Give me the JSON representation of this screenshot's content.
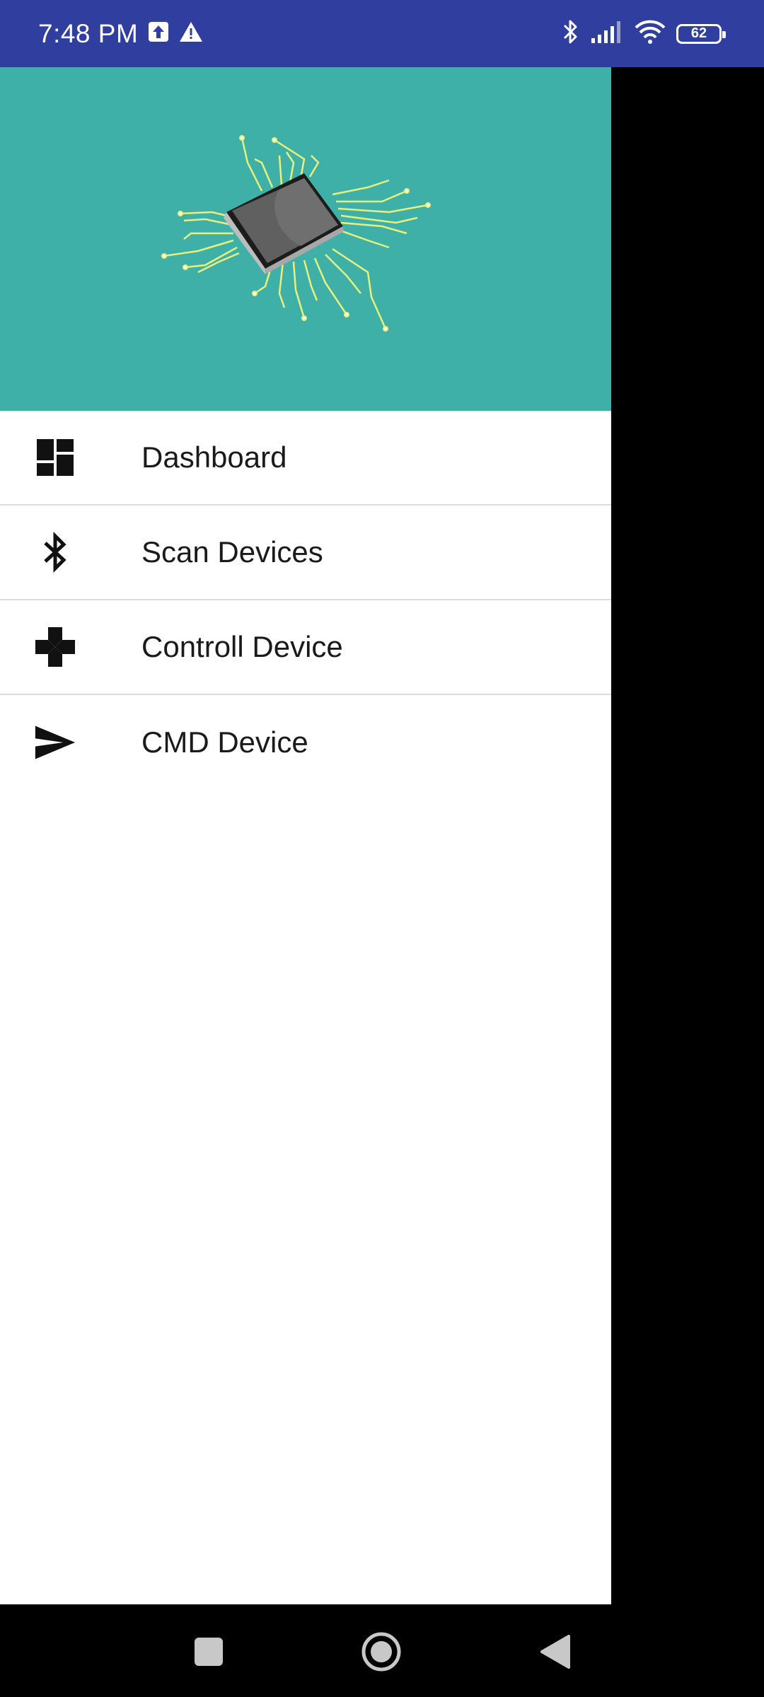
{
  "status_bar": {
    "time": "7:48 PM",
    "battery_level": "62",
    "icons": [
      "upload-icon",
      "warning-icon",
      "bluetooth-icon",
      "signal-icon",
      "wifi-icon",
      "battery-icon"
    ]
  },
  "drawer": {
    "header_image": "microchip-illustration",
    "header_color": "#3fb0a8",
    "items": [
      {
        "label": "Dashboard",
        "icon": "dashboard-icon"
      },
      {
        "label": "Scan Devices",
        "icon": "bluetooth-icon"
      },
      {
        "label": "Controll Device",
        "icon": "gamepad-icon"
      },
      {
        "label": "CMD Device",
        "icon": "send-icon"
      }
    ]
  },
  "nav_bar": {
    "buttons": [
      "recents-button",
      "home-button",
      "back-button"
    ]
  },
  "colors": {
    "status_bar": "#303f9f",
    "divider": "#dcdcdc"
  }
}
